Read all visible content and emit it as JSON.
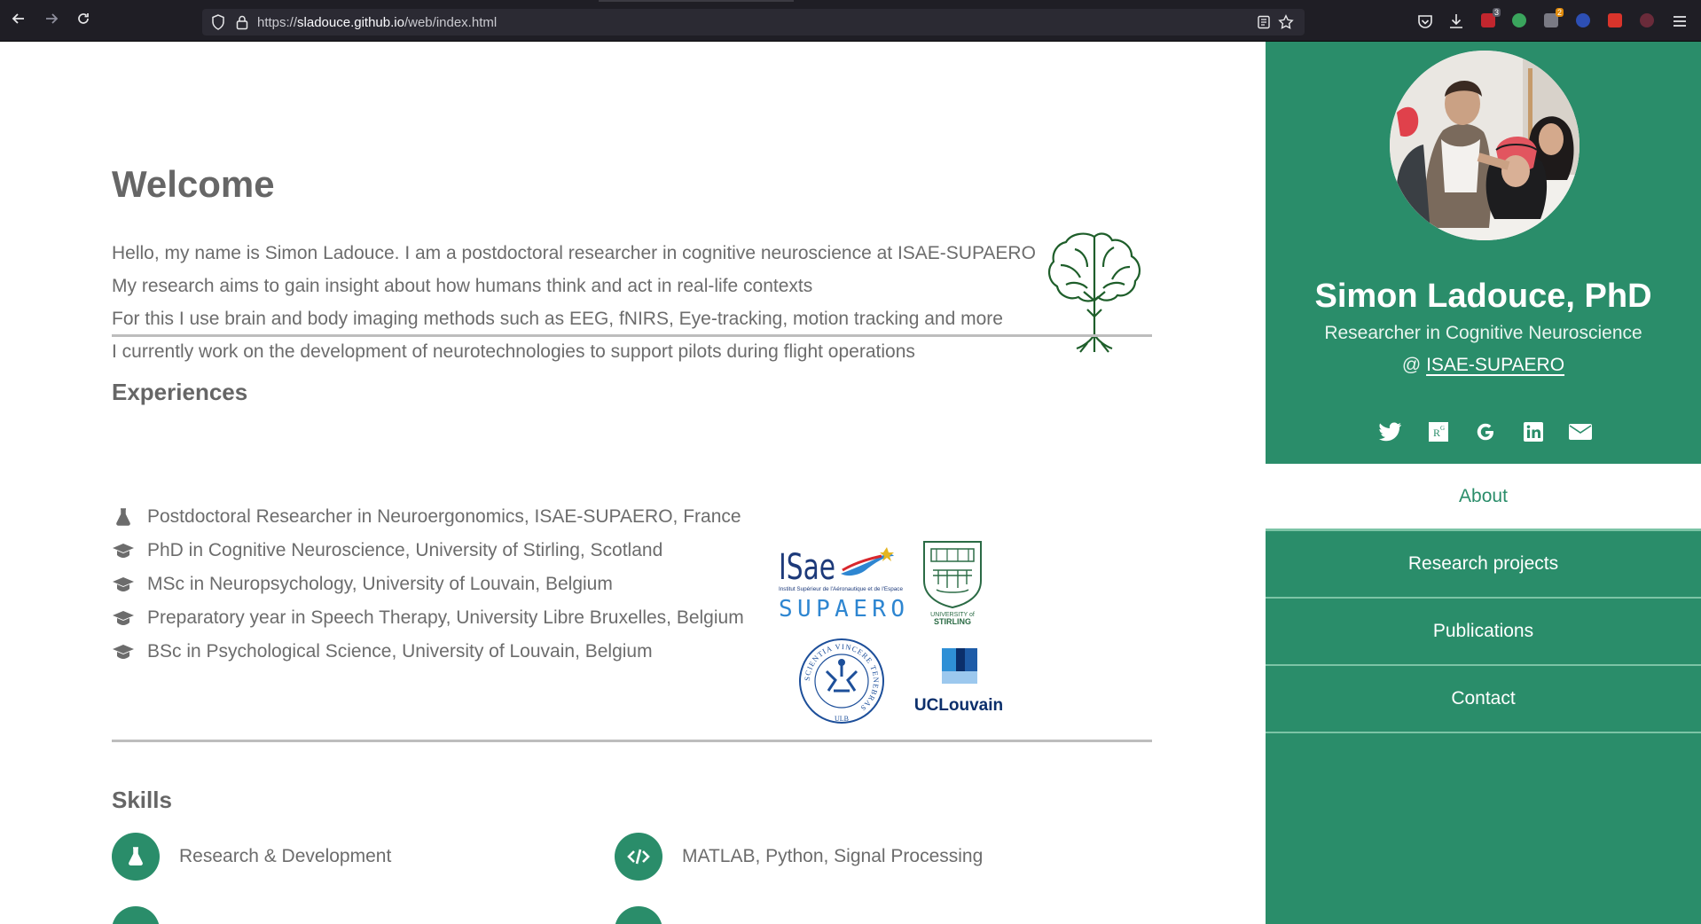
{
  "browser": {
    "url_prefix": "https://",
    "url_host": "sladouce.github.io",
    "url_path": "/web/index.html",
    "ext_badge_1": "3",
    "ext_badge_2": "2"
  },
  "main": {
    "welcome_title": "Welcome",
    "intro_lines": [
      "Hello, my name is Simon Ladouce. I am a postdoctoral researcher in cognitive neuroscience at ISAE-SUPAERO",
      "My research aims to gain insight about how humans think and act in real-life contexts",
      "For this I use brain and body imaging methods such as EEG, fNIRS, Eye-tracking, motion tracking and more",
      "I currently work on the development of neurotechnologies to support pilots during flight operations"
    ],
    "experiences_title": "Experiences",
    "experiences": [
      {
        "icon": "flask-icon",
        "text": "Postdoctoral Researcher in Neuroergonomics, ISAE-SUPAERO, France"
      },
      {
        "icon": "graduation-cap-icon",
        "text": "PhD in Cognitive Neuroscience, University of Stirling, Scotland"
      },
      {
        "icon": "graduation-cap-icon",
        "text": "MSc in Neuropsychology, University of Louvain, Belgium"
      },
      {
        "icon": "graduation-cap-icon",
        "text": "Preparatory year in Speech Therapy, University Libre Bruxelles, Belgium"
      },
      {
        "icon": "graduation-cap-icon",
        "text": "BSc in Psychological Science, University of Louvain, Belgium"
      }
    ],
    "logos": {
      "isae_top": "ISae",
      "isae_sub": "Institut Supérieur de l'Aéronautique et de l'Espace",
      "isae_bottom": "SUPAERO",
      "stirling_1": "UNIVERSITY of",
      "stirling_2": "STIRLING",
      "ulb_ring": "SCIENTIA VINCERE TENEBRAS",
      "ulb_bottom": "ULB",
      "ucl": "UCLouvain"
    },
    "skills_title": "Skills",
    "skills": [
      {
        "icon": "flask-icon",
        "text": "Research & Development"
      },
      {
        "icon": "code-icon",
        "text": "MATLAB, Python, Signal Processing"
      }
    ]
  },
  "sidebar": {
    "name": "Simon Ladouce, PhD",
    "role": "Researcher in Cognitive Neuroscience",
    "affil_prefix": "@ ",
    "affil_link": "ISAE-SUPAERO",
    "social": [
      "twitter-icon",
      "researchgate-icon",
      "google-scholar-icon",
      "linkedin-icon",
      "email-icon"
    ],
    "menu": [
      "About",
      "Research projects",
      "Publications",
      "Contact"
    ]
  },
  "colors": {
    "accent": "#2a8d6a",
    "text": "#666666",
    "divider": "#bdbdbd"
  }
}
